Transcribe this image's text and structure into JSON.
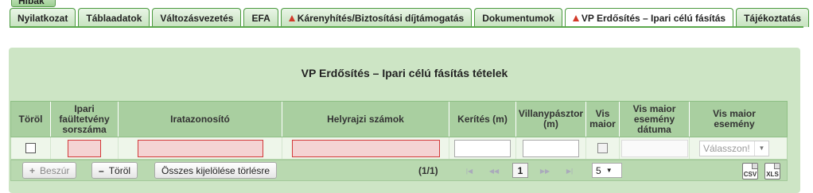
{
  "top_stub": {
    "label": "Hibák"
  },
  "tabs": [
    {
      "label": "Nyilatkozat",
      "warning": false,
      "active": false
    },
    {
      "label": "Táblaadatok",
      "warning": false,
      "active": false
    },
    {
      "label": "Változásvezetés",
      "warning": false,
      "active": false
    },
    {
      "label": "EFA",
      "warning": false,
      "active": false
    },
    {
      "label": "Kárenyhítés/Biztosítási díjtámogatás",
      "warning": true,
      "active": false
    },
    {
      "label": "Dokumentumok",
      "warning": false,
      "active": false
    },
    {
      "label": "VP Erdősítés – Ipari célú fásítás",
      "warning": true,
      "active": true
    },
    {
      "label": "Tájékoztatás",
      "warning": false,
      "active": false
    }
  ],
  "panel": {
    "title": "VP Erdősítés – Ipari célú fásítás tételek"
  },
  "table": {
    "headers": [
      "Töröl",
      "Ipari faültetvény sorszáma",
      "Iratazonosító",
      "Helyrajzi számok",
      "Kerítés (m)",
      "Villanypásztor (m)",
      "Vis maior",
      "Vis maior esemény dátuma",
      "Vis maior esemény"
    ],
    "row": {
      "event_select": "Válasszon!"
    }
  },
  "toolbar": {
    "add_label": "Beszúr",
    "delete_label": "Töröl",
    "clear_selection_label": "Összes kijelölése törlésre",
    "page_info": "(1/1)",
    "current_page": "1",
    "rows_per_page": "5",
    "csv_label": "CSV",
    "xls_label": "XLS"
  }
}
